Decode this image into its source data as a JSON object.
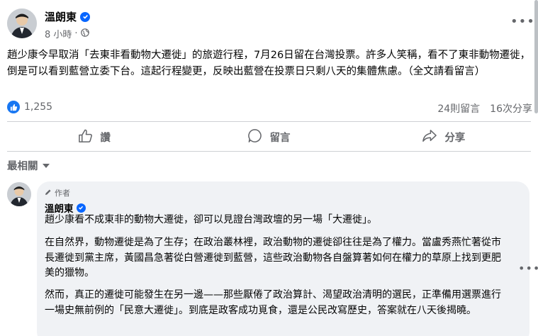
{
  "post": {
    "author": "溫朗東",
    "time": "8 小時",
    "privacy_icon": "globe-icon",
    "text": "趙少康今早取消「去東非看動物大遷徙」的旅遊行程，7月26日留在台灣投票。許多人笑稱，看不了東非動物遷徙，倒是可以看到藍營立委下台。這起行程變更，反映出藍營在投票日只剩八天的集體焦慮。（全文請看留言）",
    "reaction_count": "1,255",
    "comment_count": "24則留言",
    "share_count": "16次分享"
  },
  "actions": {
    "like": "讚",
    "comment": "留言",
    "share": "分享"
  },
  "comments_filter": "最相關",
  "comment": {
    "author_tag": "作者",
    "author": "溫朗東",
    "paragraphs": [
      "趙少康看不成東非的動物大遷徙，卻可以見證台灣政壇的另一場「大遷徙」。",
      "在自然界，動物遷徙是為了生存；在政治叢林裡，政治動物的遷徙卻往往是為了權力。當盧秀燕忙著從市長遷徙到黨主席，黃國昌急著從白營遷徙到藍營，這些政治動物各自盤算著如何在權力的草原上找到更肥美的獵物。",
      "然而，真正的遷徙可能發生在另一邊——那些厭倦了政治算計、渴望政治清明的選民，正準備用選票進行一場史無前例的「民意大遷徙」。到底是政客成功覓食，還是公民改寫歷史，答案就在八天後揭曉。"
    ]
  },
  "colors": {
    "accent": "#0866ff",
    "like_blue": "#1877f2",
    "secondary_text": "#65676b",
    "bubble_bg": "#f0f2f5"
  }
}
